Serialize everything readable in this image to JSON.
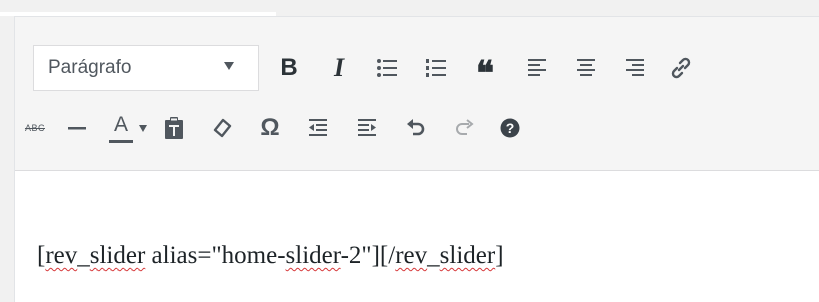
{
  "toolbar": {
    "format_select": {
      "value": "Parágrafo"
    },
    "row1": [
      {
        "name": "bold-button",
        "icon": "bold-icon",
        "glyph": "B"
      },
      {
        "name": "italic-button",
        "icon": "italic-icon",
        "glyph": "I"
      },
      {
        "name": "bullet-list-button",
        "icon": "bullet-list-icon"
      },
      {
        "name": "numbered-list-button",
        "icon": "numbered-list-icon"
      },
      {
        "name": "blockquote-button",
        "icon": "blockquote-icon",
        "glyph": "“"
      },
      {
        "name": "align-left-button",
        "icon": "align-left-icon"
      },
      {
        "name": "align-center-button",
        "icon": "align-center-icon"
      },
      {
        "name": "align-right-button",
        "icon": "align-right-icon"
      },
      {
        "name": "insert-link-button",
        "icon": "link-icon"
      }
    ],
    "row2": [
      {
        "name": "strikethrough-button",
        "icon": "strikethrough-icon",
        "glyph": "ABC"
      },
      {
        "name": "horizontal-line-button",
        "icon": "horizontal-line-icon"
      },
      {
        "name": "text-color-button",
        "icon": "text-color-icon",
        "glyph": "A"
      },
      {
        "name": "text-color-dropdown-button",
        "icon": "caret-down-icon"
      },
      {
        "name": "paste-as-text-button",
        "icon": "clipboard-icon"
      },
      {
        "name": "clear-formatting-button",
        "icon": "eraser-icon"
      },
      {
        "name": "special-character-button",
        "icon": "omega-icon",
        "glyph": "Ω"
      },
      {
        "name": "outdent-button",
        "icon": "outdent-icon"
      },
      {
        "name": "indent-button",
        "icon": "indent-icon"
      },
      {
        "name": "undo-button",
        "icon": "undo-icon"
      },
      {
        "name": "redo-button",
        "icon": "redo-icon"
      },
      {
        "name": "help-button",
        "icon": "help-icon"
      }
    ]
  },
  "content": {
    "part1": "[",
    "part2": "rev",
    "part3": "_",
    "part4": "slider",
    "part5": " alias=\"home-",
    "part6": "slider",
    "part7": "-2\"][/",
    "part8": "rev",
    "part9": "_",
    "part10": "slider",
    "part11": "]"
  },
  "colors": {
    "icon": "#50575e",
    "text_color_bar": "#50575e",
    "spellcheck": "#d63638"
  }
}
